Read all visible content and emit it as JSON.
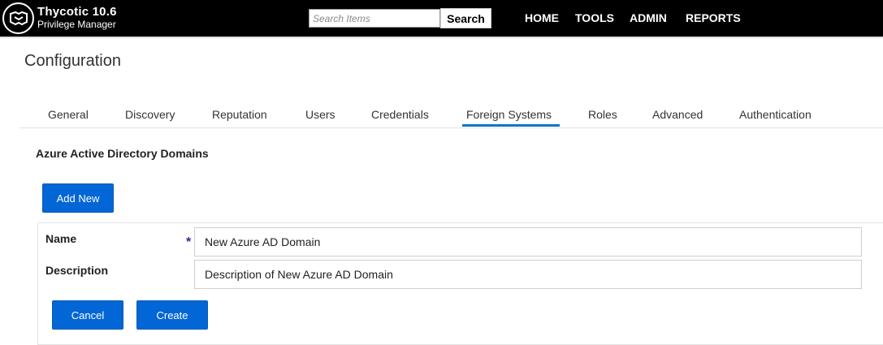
{
  "app": {
    "title": "Thycotic 10.6",
    "subtitle": "Privilege Manager",
    "logo_icon": "thycotic-logo-icon"
  },
  "search": {
    "placeholder": "Search Items",
    "value": "",
    "button_label": "Search"
  },
  "nav": {
    "items": [
      "HOME",
      "TOOLS",
      "ADMIN",
      "REPORTS"
    ]
  },
  "page": {
    "title": "Configuration"
  },
  "tabs": {
    "items": [
      "General",
      "Discovery",
      "Reputation",
      "Users",
      "Credentials",
      "Foreign Systems",
      "Roles",
      "Advanced",
      "Authentication"
    ],
    "active": "Foreign Systems"
  },
  "section": {
    "heading": "Azure Active Directory Domains",
    "add_new_label": "Add New"
  },
  "form": {
    "name_label": "Name",
    "name_value": "New Azure AD Domain",
    "required_marker": "*",
    "description_label": "Description",
    "description_value": "Description of New Azure AD Domain",
    "cancel_label": "Cancel",
    "create_label": "Create"
  },
  "colors": {
    "topbar": "#000000",
    "accent": "#0a76c9",
    "button": "#0366d6",
    "required": "#2a2aa8"
  }
}
